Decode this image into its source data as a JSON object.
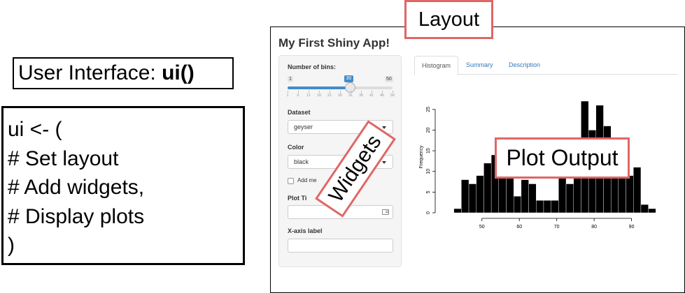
{
  "ui_label": {
    "prefix": "User Interface: ",
    "func": "ui()"
  },
  "code": {
    "lines": [
      "ui <- (",
      "# Set layout",
      "# Add widgets,",
      "# Display plots",
      ")"
    ]
  },
  "app": {
    "title": "My First Shiny App!",
    "sidebar": {
      "bins": {
        "label": "Number of bins:",
        "min": "1",
        "max": "50",
        "value": "30",
        "fraction": 0.59,
        "ticks": [
          "1",
          "6",
          "11",
          "16",
          "21",
          "26",
          "31",
          "36",
          "41",
          "46",
          "50"
        ]
      },
      "dataset": {
        "label": "Dataset",
        "selected": "geyser"
      },
      "color": {
        "label": "Color",
        "selected": "black"
      },
      "checkbox": {
        "label": "Add me"
      },
      "plot_title": {
        "label": "Plot Ti",
        "value": ""
      },
      "xaxis_label": {
        "label": "X-axis label",
        "value": ""
      }
    },
    "tabs": [
      "Histogram",
      "Summary",
      "Description"
    ],
    "active_tab": "Histogram"
  },
  "annotations": {
    "layout": "Layout",
    "widgets": "Widgets",
    "plot_output": "Plot Output"
  },
  "colors": {
    "annotation_border": "#e06666",
    "slider_blue": "#428bca",
    "tab_link": "#337ab7",
    "bars": "#000000"
  },
  "chart_data": {
    "type": "bar",
    "title": "",
    "xlabel": "",
    "ylabel": "Frequency",
    "x": [
      43.5,
      45.5,
      47.5,
      49.5,
      51.5,
      53.5,
      55.5,
      57.5,
      59.5,
      61.5,
      63.5,
      65.5,
      67.5,
      69.5,
      71.5,
      73.5,
      75.5,
      77.5,
      79.5,
      81.5,
      83.5,
      85.5,
      87.5,
      89.5,
      91.5,
      93.5,
      95.5
    ],
    "values": [
      1,
      8,
      7,
      9,
      12,
      14,
      9,
      15,
      4,
      8,
      7,
      3,
      3,
      3,
      10,
      7,
      10,
      27,
      20,
      26,
      21,
      15,
      10,
      9,
      11,
      2,
      1
    ],
    "xticks": [
      50,
      60,
      70,
      80,
      90
    ],
    "yticks": [
      0,
      5,
      10,
      15,
      20,
      25
    ],
    "xlim": [
      42,
      97
    ],
    "ylim": [
      0,
      27
    ],
    "grid": false
  }
}
